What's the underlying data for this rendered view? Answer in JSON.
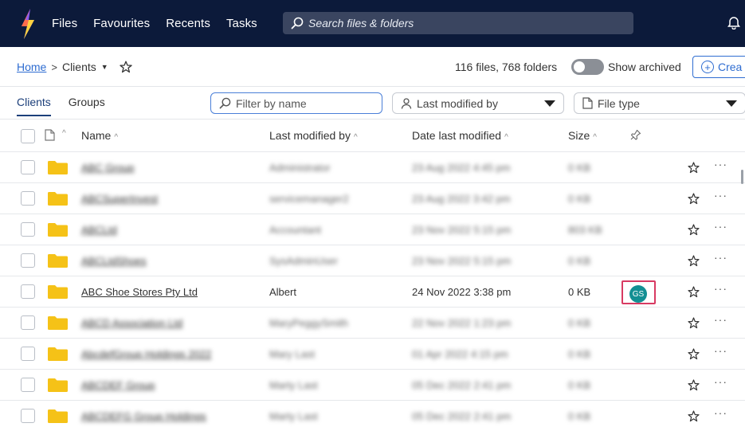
{
  "topbar": {
    "nav": [
      "Files",
      "Favourites",
      "Recents",
      "Tasks"
    ],
    "search_placeholder": "Search files & folders"
  },
  "breadcrumb": {
    "home": "Home",
    "separator": ">",
    "current": "Clients"
  },
  "summary": {
    "counts": "116 files, 768 folders",
    "show_archived": "Show archived",
    "create": "Crea"
  },
  "tabs": [
    "Clients",
    "Groups"
  ],
  "filters": {
    "filter_placeholder": "Filter by name",
    "last_modified_by": "Last modified by",
    "file_type": "File type"
  },
  "columns": {
    "name": "Name",
    "last_modified_by": "Last modified by",
    "date_last_modified": "Date last modified",
    "size": "Size"
  },
  "rows": [
    {
      "name": "ABC Group",
      "modified_by": "Administrator",
      "date": "23 Aug 2022 4:45 pm",
      "size": "0 KB",
      "blurred": true
    },
    {
      "name": "ABCSuperInvest",
      "modified_by": "servicemanager2",
      "date": "23 Aug 2022 3:42 pm",
      "size": "0 KB",
      "blurred": true
    },
    {
      "name": "ABCLtd",
      "modified_by": "Accountant",
      "date": "23 Nov 2022 5:15 pm",
      "size": "803 KB",
      "blurred": true
    },
    {
      "name": "ABCLtdShoes",
      "modified_by": "SysAdminUser",
      "date": "23 Nov 2022 5:15 pm",
      "size": "0 KB",
      "blurred": true
    },
    {
      "name": "ABC Shoe Stores Pty Ltd",
      "modified_by": "Albert",
      "date": "24 Nov 2022 3:38 pm",
      "size": "0 KB",
      "blurred": false,
      "owner": "GS"
    },
    {
      "name": "ABCD Association Ltd",
      "modified_by": "MaryPeggySmith",
      "date": "22 Nov 2022 1:23 pm",
      "size": "0 KB",
      "blurred": true
    },
    {
      "name": "AbcdefGroup Holdings 2022",
      "modified_by": "Mary Last",
      "date": "01 Apr 2022 4:15 pm",
      "size": "0 KB",
      "blurred": true
    },
    {
      "name": "ABCDEF Group",
      "modified_by": "Marty Last",
      "date": "05 Dec 2022 2:41 pm",
      "size": "0 KB",
      "blurred": true
    },
    {
      "name": "ABCDEFG Group Holdings",
      "modified_by": "Marty Last",
      "date": "05 Dec 2022 2:41 pm",
      "size": "0 KB",
      "blurred": true
    }
  ],
  "colors": {
    "topbar": "#0c1a3a",
    "link": "#2f6dd1",
    "folder": "#f5c217",
    "badge": "#138f93",
    "highlight": "#d83a62"
  }
}
